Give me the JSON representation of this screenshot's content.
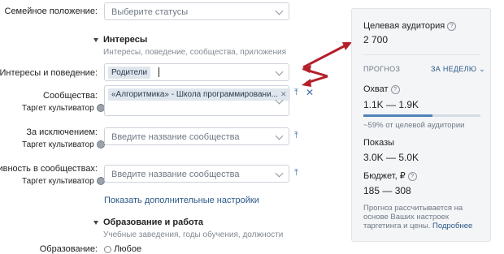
{
  "marital": {
    "label": "Семейное положение:",
    "placeholder": "Выберите статусы"
  },
  "interests_section": {
    "title": "Интересы",
    "desc": "Интересы, поведение, сообщества, приложения"
  },
  "interests": {
    "label": "Интересы и поведение:",
    "tag": "Родители"
  },
  "communities": {
    "label": "Сообщества:",
    "sublabel": "Таргет культиватор",
    "tag": "«Алгоритмика» - Школа программировани..."
  },
  "exclusions": {
    "label": "За исключением:",
    "sublabel": "Таргет культиватор",
    "placeholder": "Введите название сообщества"
  },
  "activity": {
    "label": "Активность в сообществах:",
    "sublabel": "Таргет культиватор",
    "placeholder": "Введите название сообщества"
  },
  "more_settings_link": "Показать дополнительные настройки",
  "education_section": {
    "title": "Образование и работа",
    "desc": "Учебные заведения, годы обучения, должности"
  },
  "bottom_cut": {
    "label": "Образование:",
    "value": "Любое"
  },
  "panel": {
    "audience_label": "Целевая аудитория",
    "audience_value": "2 700",
    "forecast_label": "ПРОГНОЗ",
    "period_label": "ЗА НЕДЕЛЮ",
    "reach_label": "Охват",
    "reach_value": "1.1K — 1.9K",
    "reach_share_text": "~59% от целевой аудитории",
    "reach_share_fraction": 0.59,
    "impressions_label": "Показы",
    "impressions_value": "3.0K — 5.0K",
    "budget_label": "Бюджет, ₽",
    "budget_value": "185 — 308",
    "note": "Прогноз рассчитывается на основе Ваших настроек таргетинга и цены.",
    "more_link": "Подробнее"
  },
  "colors": {
    "accent": "#2a5885",
    "arrow": "#b3202a",
    "bar": "#5181b8"
  }
}
